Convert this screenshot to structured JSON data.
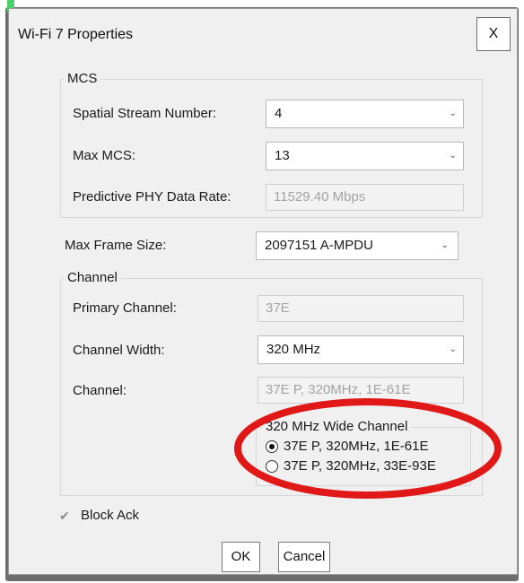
{
  "dialog": {
    "title": "Wi-Fi 7 Properties",
    "close_label": "X"
  },
  "mcs": {
    "legend": "MCS",
    "spatial_stream_label": "Spatial Stream Number:",
    "spatial_stream_value": "4",
    "max_mcs_label": "Max MCS:",
    "max_mcs_value": "13",
    "phy_rate_label": "Predictive PHY Data Rate:",
    "phy_rate_value": "11529.40 Mbps"
  },
  "frame": {
    "max_frame_label": "Max Frame Size:",
    "max_frame_value": "2097151 A-MPDU"
  },
  "channel": {
    "legend": "Channel",
    "primary_label": "Primary Channel:",
    "primary_value": "37E",
    "width_label": "Channel Width:",
    "width_value": "320 MHz",
    "channel_label": "Channel:",
    "channel_value": "37E P, 320MHz, 1E-61E",
    "wide": {
      "legend": "320 MHz Wide Channel",
      "options": [
        "37E P, 320MHz, 1E-61E",
        "37E P, 320MHz, 33E-93E"
      ],
      "selected_index": 0
    }
  },
  "block_ack": {
    "label": "Block Ack",
    "checked": true
  },
  "buttons": {
    "ok": "OK",
    "cancel": "Cancel"
  },
  "icons": {
    "dropdown": "chevron-down-icon",
    "check": "checkmark-icon",
    "close": "close-icon"
  },
  "colors": {
    "highlight_ring": "#e01818",
    "disabled_text": "#a3a3a3",
    "background": "#f0f0f0"
  }
}
